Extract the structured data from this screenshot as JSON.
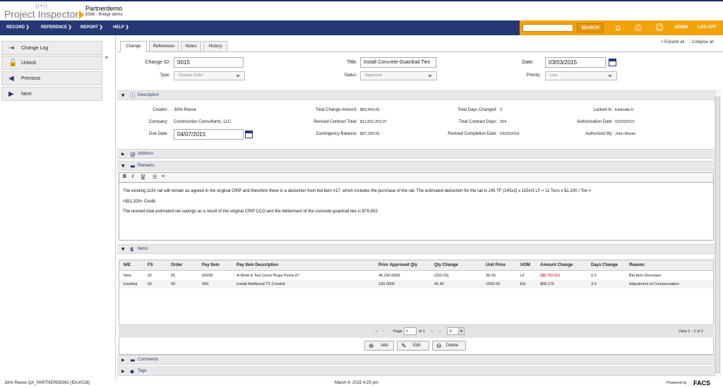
{
  "app": {
    "logo_text": "Project Inspector",
    "project_name": "Partnerdemo",
    "project_sub": "5568 - Bridge demo"
  },
  "nav": {
    "items": [
      "RECORD",
      "REFERENCE",
      "REPORT",
      "HELP"
    ],
    "search_button": "SEARCH",
    "admin": "ADMIN",
    "logoff": "LOG OFF"
  },
  "sidebar": {
    "items": [
      {
        "label": "Change Log",
        "icon": "exit-icon"
      },
      {
        "label": "Unlock",
        "icon": "unlock-icon"
      },
      {
        "label": "Previous",
        "icon": "arrow-left-icon"
      },
      {
        "label": "Next",
        "icon": "arrow-right-icon"
      }
    ],
    "collapse_glyph": "«"
  },
  "tabs": [
    "Change",
    "References",
    "Notes",
    "History"
  ],
  "expand_all": "+ Expand all",
  "collapse_all": "- Collapse all",
  "form": {
    "change_id_label": "Change ID:",
    "change_id": "0015",
    "title_label": "Title:",
    "title": "Install Concrete Guardrail Ties",
    "date_label": "Date:",
    "date": "03/03/2015",
    "type_label": "Type:",
    "type": "Change Order",
    "status_label": "Status:",
    "status": "Approved",
    "priority_label": "Priority:",
    "priority": "Low"
  },
  "description": {
    "section_title": "Description",
    "creator_label": "Creator:",
    "creator": "John Reese",
    "company_label": "Company:",
    "company": "Construction Consultants, LLC",
    "due_date_label": "Due Date:",
    "due_date": "04/07/2015",
    "total_change_amount_label": "Total Change Amount:",
    "total_change_amount": "$59,425.00",
    "revised_contract_total_label": "Revised Contract Total:",
    "revised_contract_total": "$11,822,253.07",
    "contingency_balance_label": "Contingency Balance:",
    "contingency_balance": "$97,200.00",
    "total_days_changed_label": "Total Days Changed:",
    "total_days_changed": "3",
    "total_contract_days_label": "Total Contract Days:",
    "total_contract_days": "254",
    "revised_completion_date_label": "Revised Completion Date:",
    "revised_completion_date": "03/26/2016",
    "locked_in_label": "Locked In:",
    "locked_in": "Estimate 6",
    "authorization_date_label": "Authorization Date:",
    "authorization_date": "02/03/2015",
    "authorized_by_label": "Authorized By:",
    "authorized_by": "John Reese"
  },
  "address": {
    "section_title": "Address"
  },
  "remarks": {
    "section_title": "Remarks",
    "toolbar": [
      "B",
      "I",
      "U"
    ],
    "line1": "The existing 115# rail will remain as agreed in the original CRIP and therefore there is a deduction from bid item #17, which includes the purchase of the rail. The estimated deduction for the rail is 245 TF (245x2) x 115#/3 LF = 11 Tons x $1,200 / Ton =",
    "line2": "<$11,329> Credit.",
    "line3": "The revised total estimated net savings as a result of the original CRIP CCO and the betterment of the concrete guardrail ties is $79,852."
  },
  "items": {
    "section_title": "Items",
    "columns": [
      "N/E",
      "FS",
      "Order",
      "Pay Item",
      "Pay Item Description",
      "Prior Approved Qty",
      "Qty Change",
      "Unit Price",
      "UOM",
      "Amount Change",
      "Days Change",
      "Reason"
    ],
    "rows": [
      [
        "New",
        "02",
        "55",
        "55658",
        "A-Weld & Test Grout Plugs Portal 97",
        "46,250.0000",
        "(250.00)",
        "35.00",
        "LF",
        "($8,750.00)",
        "0.0",
        "Bid Item Decrease"
      ],
      [
        "Existing",
        "02",
        "99",
        "99X",
        "Install Additional TS Conduit",
        "100.0000",
        "45.45",
        "1500.00",
        "EA",
        "$68,175",
        "3.0",
        "Adjustment of Compensation"
      ]
    ],
    "negative_color": "#cc0000",
    "pager": {
      "page_label": "Page",
      "page": "1",
      "of_label": "of 1",
      "page_size": "6",
      "view_info": "View 1 - 2 of 2"
    },
    "add_button": "Add",
    "edit_button": "Edit",
    "delete_button": "Delete"
  },
  "comments": {
    "section_title": "Comments"
  },
  "tags": {
    "section_title": "Tags"
  },
  "footer": {
    "user": "John Reese  QA_PARTNERDEMO (IDU#218)",
    "datetime": "March 4, 2015 4:25 pm",
    "powered_by": "Powered by",
    "brand": "FACS"
  },
  "colors": {
    "nav_bg": "#243874",
    "accent": "#f0a30a"
  }
}
